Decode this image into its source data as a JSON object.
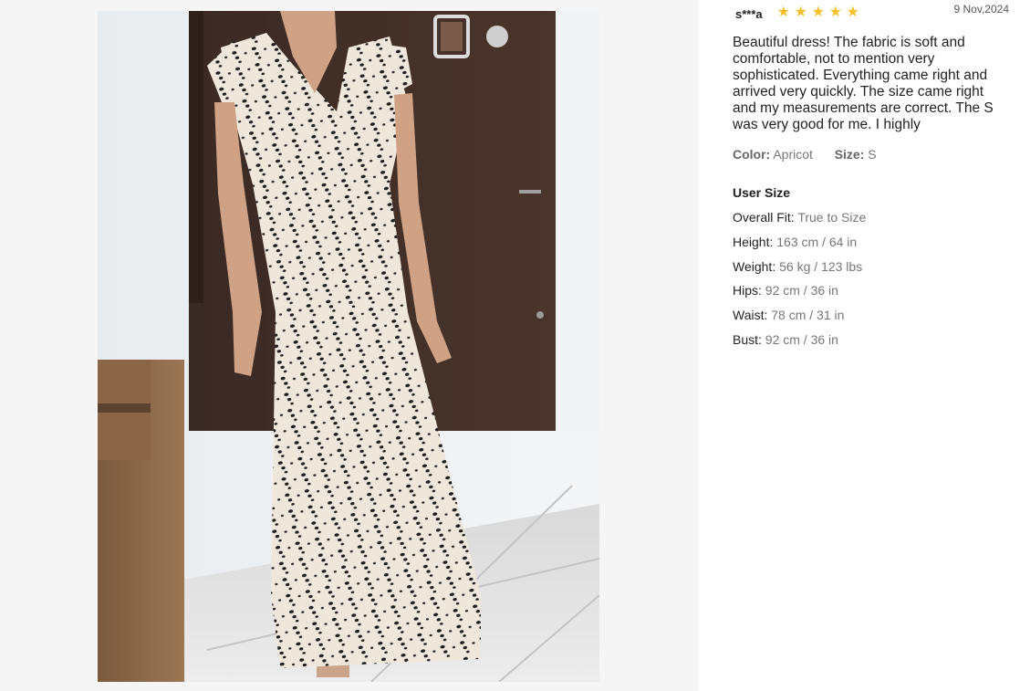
{
  "review": {
    "username": "s***a",
    "rating": 5,
    "star_icon": "★",
    "date": "9 Nov,2024",
    "text": "Beautiful dress! The fabric is soft and comfortable, not to mention very sophisticated. Everything came right and arrived very quickly. The size came right and my measurements are correct. The S was very good for me. I highly",
    "color_label": "Color:",
    "color_value": "Apricot",
    "size_label": "Size:",
    "size_value": "S"
  },
  "user_size": {
    "title": "User Size",
    "items": [
      {
        "label": "Overall Fit:",
        "value": "True to Size"
      },
      {
        "label": "Height:",
        "value": "163 cm / 64 in"
      },
      {
        "label": "Weight:",
        "value": "56 kg / 123 lbs"
      },
      {
        "label": "Hips:",
        "value": "92 cm / 36 in"
      },
      {
        "label": "Waist:",
        "value": "78 cm / 31 in"
      },
      {
        "label": "Bust:",
        "value": "92 cm / 36 in"
      }
    ]
  },
  "colors": {
    "star": "#f5c02b",
    "panel_bg": "#f5f5f5"
  }
}
